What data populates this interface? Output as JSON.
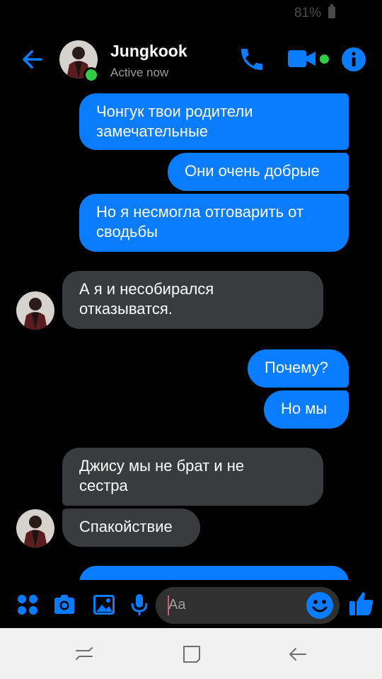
{
  "status_bar": {
    "battery": "81%"
  },
  "header": {
    "name": "Jungkook",
    "status": "Active now"
  },
  "messages": [
    {
      "side": "out",
      "text": "Чонгук твои родители\nзамечательные"
    },
    {
      "side": "out",
      "text": "Они очень добрые"
    },
    {
      "side": "out",
      "text": "Но я несмогла отговарить от\nсводьбы"
    },
    {
      "side": "in",
      "text": "А я и несобирался\nотказыватся."
    },
    {
      "side": "out",
      "text": "Почему?"
    },
    {
      "side": "out",
      "text": "Но мы"
    },
    {
      "side": "in",
      "text": "Джису мы не брат и не\nсестра"
    },
    {
      "side": "in",
      "text": "Спакойствие"
    }
  ],
  "composer": {
    "placeholder": "Aa"
  },
  "colors": {
    "accent": "#0a7cff",
    "incoming": "#3a3b3c",
    "online": "#31cc46"
  },
  "icons": [
    "back-arrow-icon",
    "phone-icon",
    "video-camera-icon",
    "info-icon",
    "apps-icon",
    "camera-icon",
    "gallery-icon",
    "microphone-icon",
    "emoji-icon",
    "thumbs-up-icon",
    "recent-apps-icon",
    "home-icon",
    "back-icon"
  ]
}
